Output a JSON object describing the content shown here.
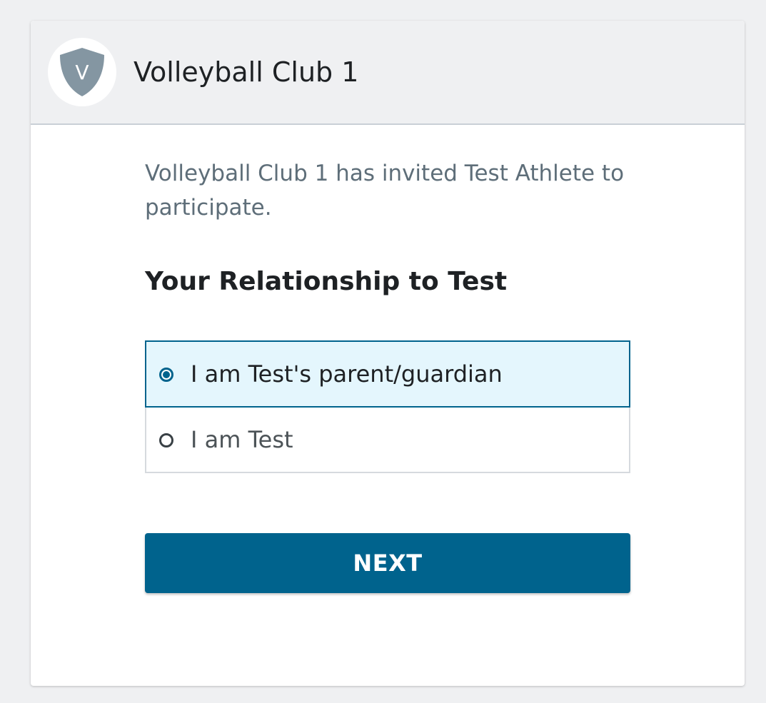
{
  "header": {
    "logo_letter": "V",
    "club_name": "Volleyball Club 1"
  },
  "main": {
    "invite_text": "Volleyball Club 1 has invited Test Athlete to participate.",
    "section_title": "Your Relationship to Test",
    "options": [
      {
        "label": "I am Test's parent/guardian",
        "selected": true
      },
      {
        "label": "I am Test",
        "selected": false
      }
    ],
    "next_label": "NEXT"
  },
  "colors": {
    "accent": "#00638d",
    "selected_bg": "#e4f6fd",
    "header_bg": "#eff0f2",
    "shield": "#8496a2"
  },
  "icons": {
    "logo": "shield-icon",
    "radio_selected": "radio-checked-icon",
    "radio_unselected": "radio-unchecked-icon"
  }
}
